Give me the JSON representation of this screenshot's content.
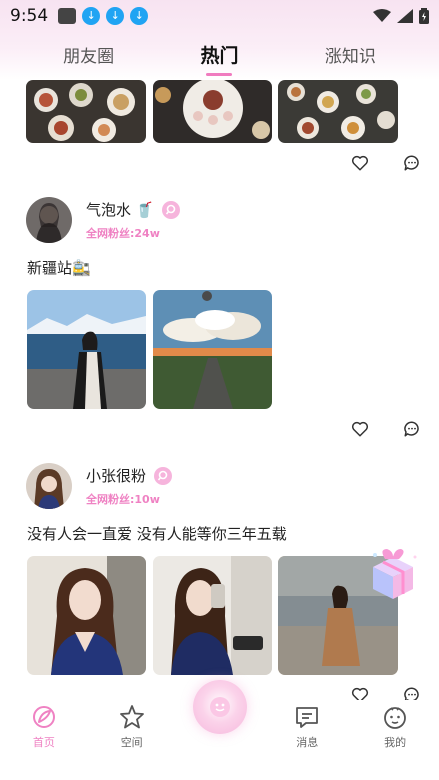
{
  "status_bar": {
    "time": "9:54",
    "icons": [
      "mail-icon",
      "download-icon",
      "download-icon",
      "download-icon",
      "wifi-icon",
      "signal-icon",
      "battery-icon"
    ]
  },
  "tabs": [
    {
      "label": "朋友圈",
      "active": false
    },
    {
      "label": "热门",
      "active": true
    },
    {
      "label": "涨知识",
      "active": false
    }
  ],
  "posts": [
    {
      "name": "气泡水",
      "name_emoji": "🥤",
      "fans": "全网粉丝:24w",
      "text": "新疆站🚉"
    },
    {
      "name": "小张很粉",
      "fans": "全网粉丝:10w",
      "text": "没有人会一直爱 没有人能等你三年五载"
    }
  ],
  "bottom_nav": [
    {
      "label": "首页",
      "icon": "home-icon",
      "active": true
    },
    {
      "label": "空间",
      "icon": "star-icon",
      "active": false
    },
    {
      "label": "消息",
      "icon": "message-icon",
      "active": false
    },
    {
      "label": "我的",
      "icon": "face-icon",
      "active": false
    }
  ],
  "colors": {
    "accent": "#ef82c3",
    "header_bg": "#f7e3f1"
  }
}
